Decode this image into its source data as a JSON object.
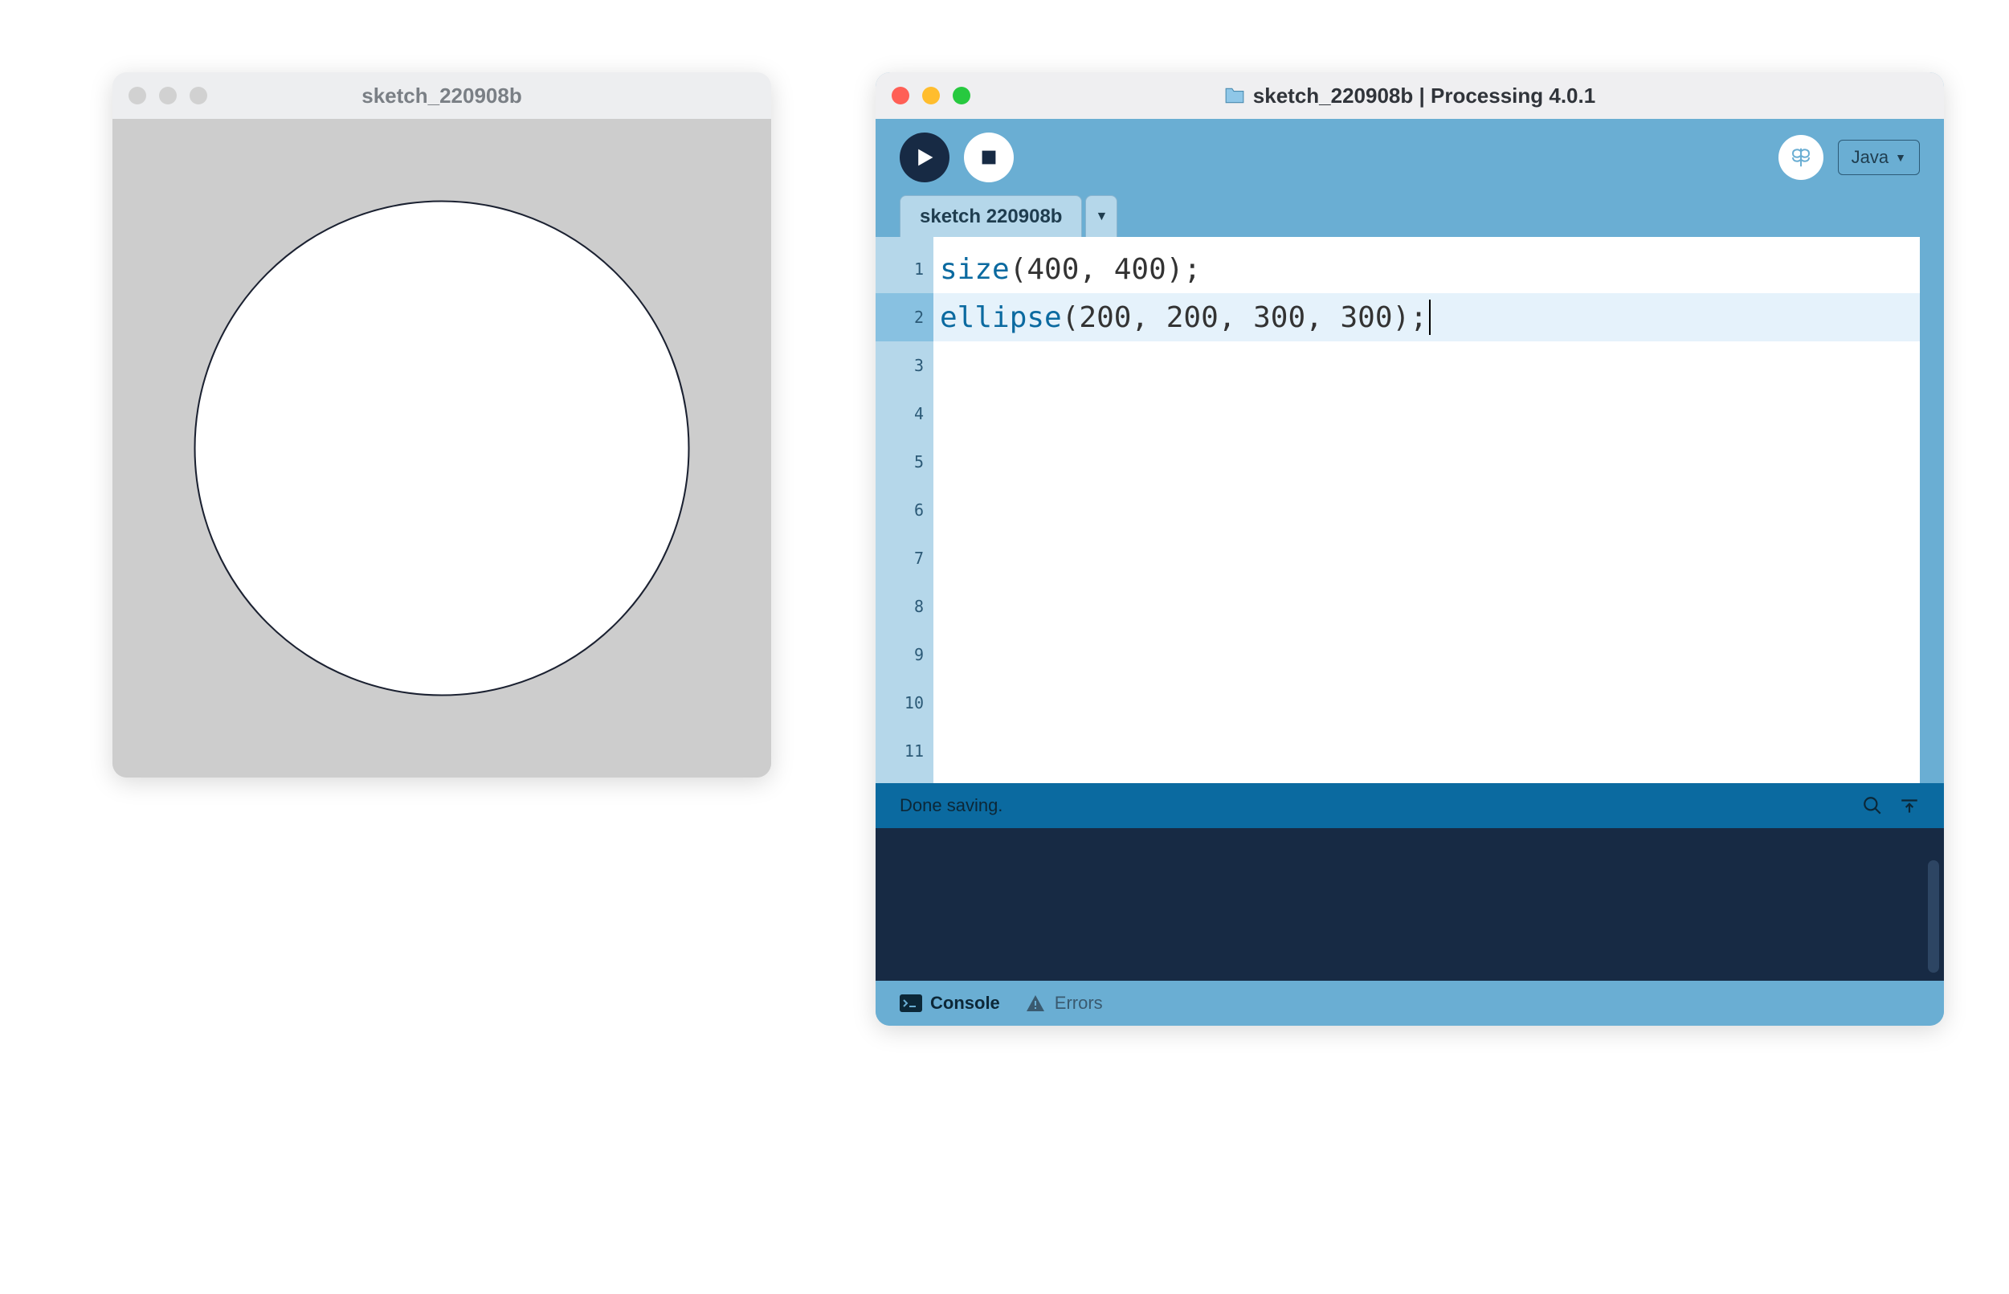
{
  "sketch_window": {
    "title": "sketch_220908b",
    "canvas": {
      "bg": "#cdcdcd",
      "circle_fill": "#ffffff",
      "circle_stroke": "#1b2131"
    }
  },
  "ide": {
    "title": "sketch_220908b | Processing 4.0.1",
    "toolbar": {
      "run_label": "Run",
      "stop_label": "Stop",
      "debug_label": "Debug",
      "mode_label": "Java"
    },
    "tabs": [
      {
        "label": "sketch 220908b"
      }
    ],
    "code_lines": [
      {
        "n": 1,
        "func": "size",
        "args": "(400, 400);",
        "hl": false
      },
      {
        "n": 2,
        "func": "ellipse",
        "args": "(200, 200, 300, 300);",
        "hl": true
      },
      {
        "n": 3,
        "func": "",
        "args": "",
        "hl": false
      },
      {
        "n": 4,
        "func": "",
        "args": "",
        "hl": false
      },
      {
        "n": 5,
        "func": "",
        "args": "",
        "hl": false
      },
      {
        "n": 6,
        "func": "",
        "args": "",
        "hl": false
      },
      {
        "n": 7,
        "func": "",
        "args": "",
        "hl": false
      },
      {
        "n": 8,
        "func": "",
        "args": "",
        "hl": false
      },
      {
        "n": 9,
        "func": "",
        "args": "",
        "hl": false
      },
      {
        "n": 10,
        "func": "",
        "args": "",
        "hl": false
      },
      {
        "n": 11,
        "func": "",
        "args": "",
        "hl": false
      }
    ],
    "status": {
      "message": "Done saving."
    },
    "bottom_tabs": {
      "console": "Console",
      "errors": "Errors"
    }
  }
}
